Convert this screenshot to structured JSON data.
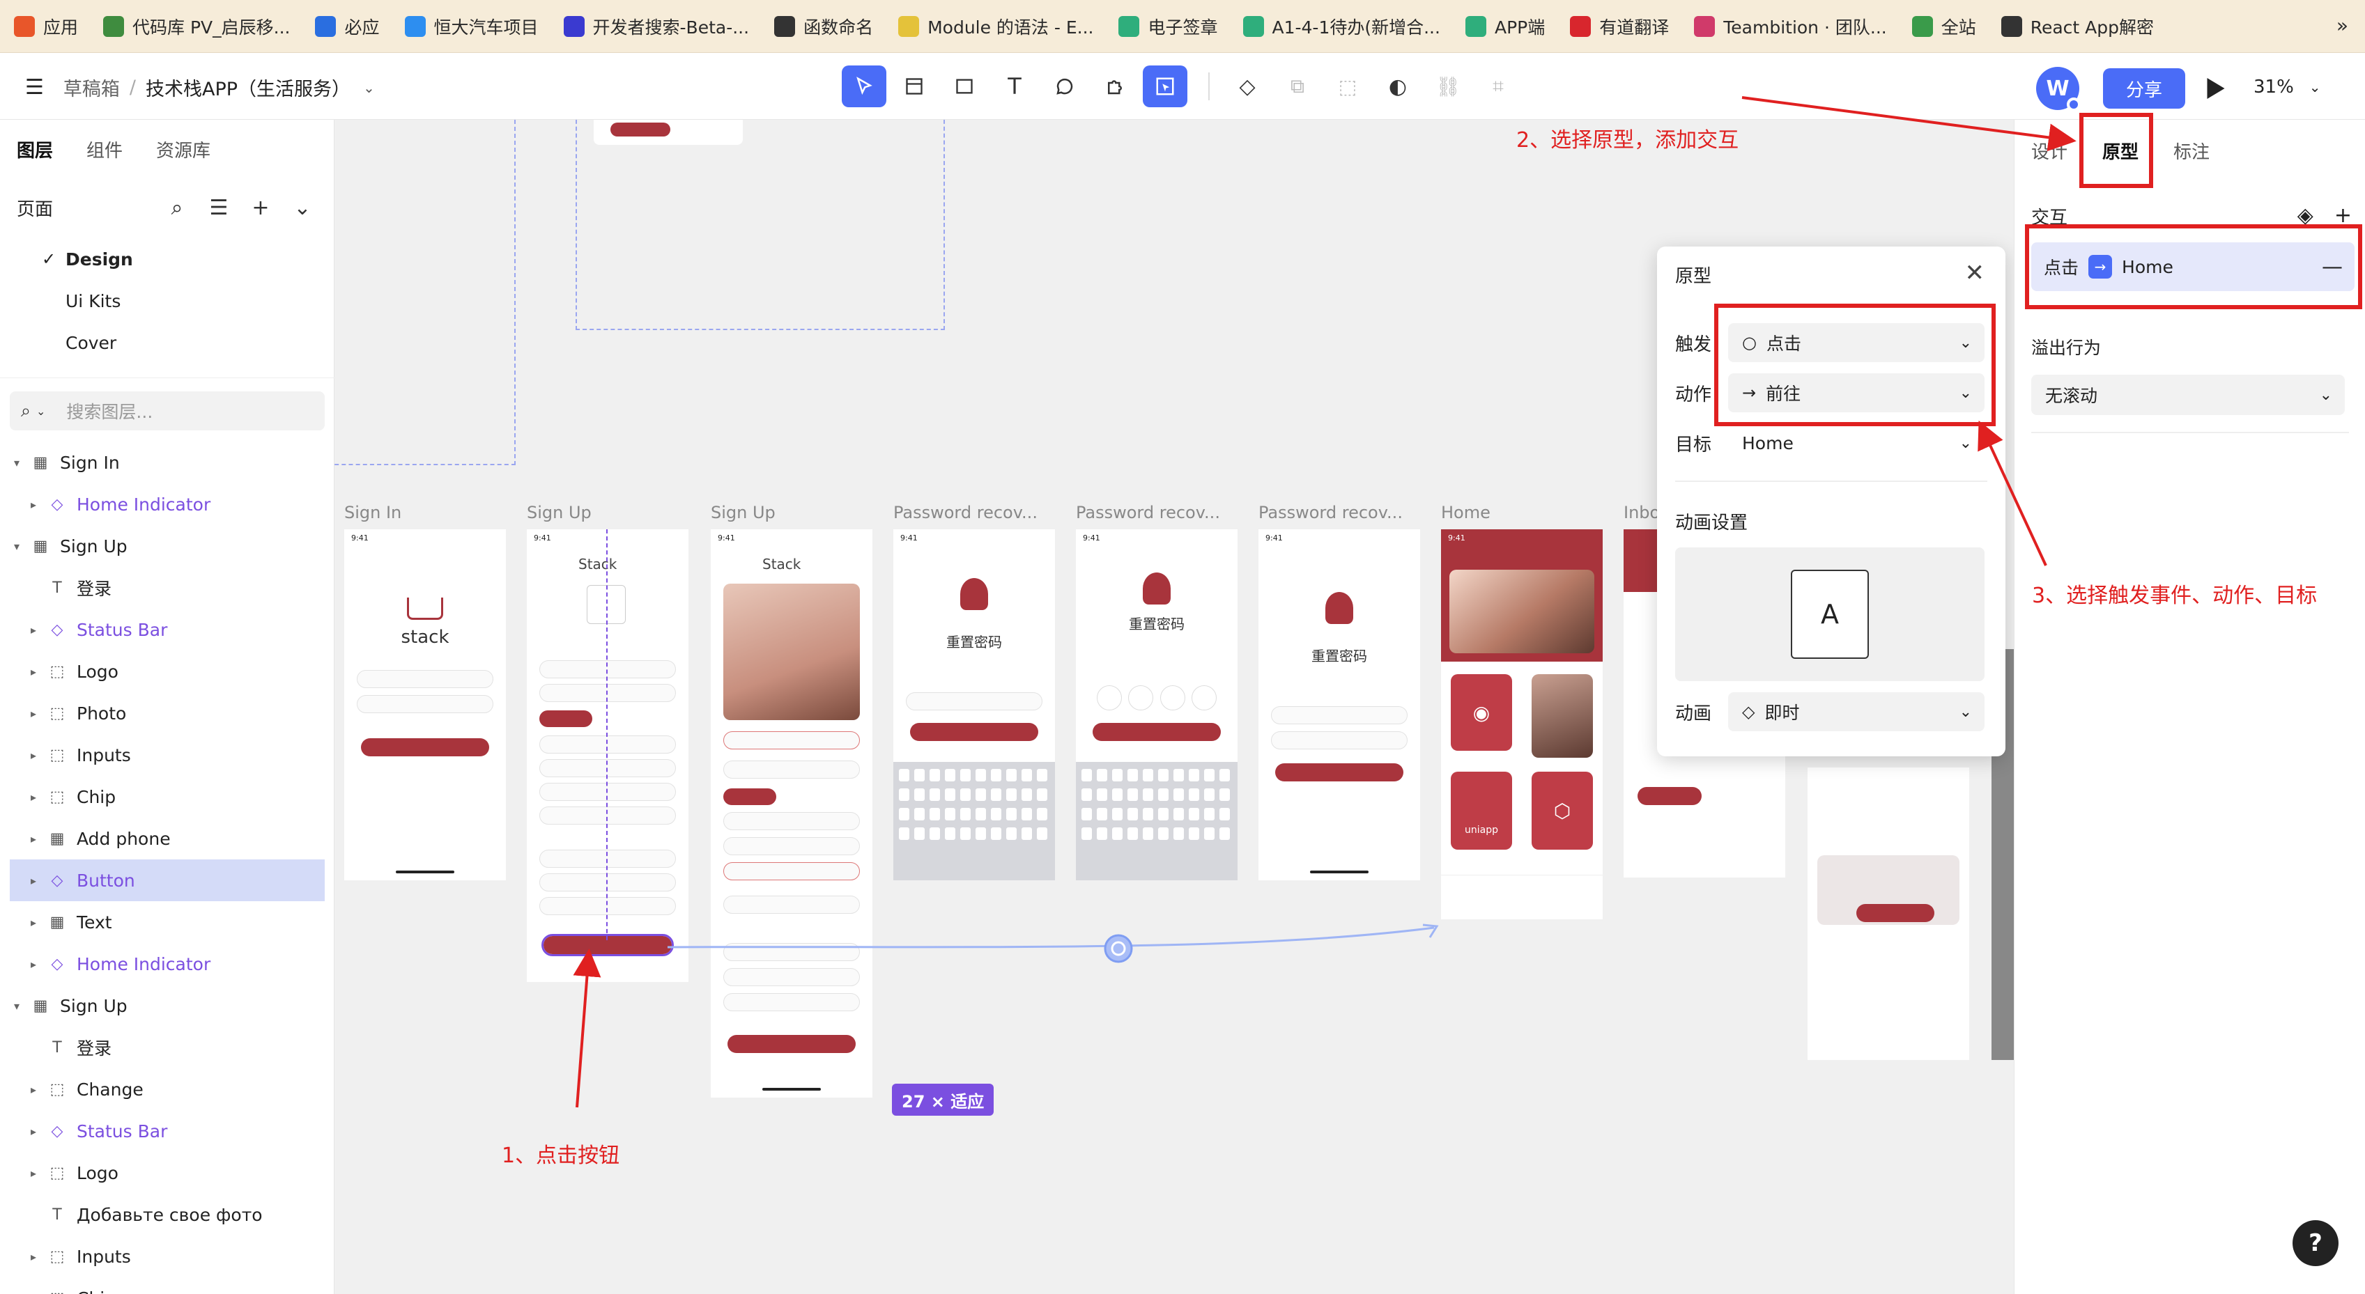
{
  "bookmarks": [
    {
      "label": "应用",
      "icon": "apps-grid-icon",
      "color": "#e8562a"
    },
    {
      "label": "代码库 PV_启辰移...",
      "icon": "chrome-icon",
      "color": "#3f8c3f"
    },
    {
      "label": "必应",
      "icon": "search-icon",
      "color": "#2a6ee0"
    },
    {
      "label": "恒大汽车项目",
      "icon": "tencent-icon",
      "color": "#2d8ef0"
    },
    {
      "label": "开发者搜索-Beta-...",
      "icon": "dev-search-icon",
      "color": "#3a3ad0"
    },
    {
      "label": "函数命名",
      "icon": "doc-icon",
      "color": "#333333"
    },
    {
      "label": "Module 的语法 - E...",
      "icon": "es-icon",
      "color": "#e4c23a"
    },
    {
      "label": "电子签章",
      "icon": "play-icon",
      "color": "#2fae7c"
    },
    {
      "label": "A1-4-1待办(新增合...",
      "icon": "play-icon",
      "color": "#2fae7c"
    },
    {
      "label": "APP端",
      "icon": "play-icon",
      "color": "#2fae7c"
    },
    {
      "label": "有道翻译",
      "icon": "youdao-icon",
      "color": "#d8262d"
    },
    {
      "label": "Teambition · 团队...",
      "icon": "teambition-icon",
      "color": "#d03a6a"
    },
    {
      "label": "全站",
      "icon": "site-icon",
      "color": "#3a9b4a"
    },
    {
      "label": "React App解密",
      "icon": "react-icon",
      "color": "#333333"
    }
  ],
  "bookmarks_more": "»",
  "toolbar": {
    "drafts": "草稿箱",
    "project": "技术栈APP（生活服务）",
    "avatar_letter": "W",
    "share": "分享",
    "zoom": "31%"
  },
  "left_panel": {
    "tabs": [
      "图层",
      "组件",
      "资源库"
    ],
    "pages_label": "页面",
    "pages": [
      "Design",
      "Ui Kits",
      "Cover"
    ],
    "search_placeholder": "搜索图层..."
  },
  "layers": [
    {
      "label": "Sign In",
      "type": "frame",
      "level": 0,
      "expanded": true
    },
    {
      "label": "Home Indicator",
      "type": "component",
      "level": 1
    },
    {
      "label": "Sign Up",
      "type": "frame",
      "level": 0,
      "expanded": true
    },
    {
      "label": "登录",
      "type": "text",
      "level": 1
    },
    {
      "label": "Status Bar",
      "type": "component",
      "level": 1
    },
    {
      "label": "Logo",
      "type": "group",
      "level": 1
    },
    {
      "label": "Photo",
      "type": "group",
      "level": 1
    },
    {
      "label": "Inputs",
      "type": "group",
      "level": 1
    },
    {
      "label": "Chip",
      "type": "group",
      "level": 1
    },
    {
      "label": "Add phone",
      "type": "frame",
      "level": 1
    },
    {
      "label": "Button",
      "type": "component",
      "level": 1,
      "selected": true
    },
    {
      "label": "Text",
      "type": "frame",
      "level": 1
    },
    {
      "label": "Home Indicator",
      "type": "component",
      "level": 1
    },
    {
      "label": "Sign Up",
      "type": "frame",
      "level": 0,
      "expanded": true
    },
    {
      "label": "登录",
      "type": "text",
      "level": 1
    },
    {
      "label": "Change",
      "type": "group",
      "level": 1
    },
    {
      "label": "Status Bar",
      "type": "component",
      "level": 1
    },
    {
      "label": "Logo",
      "type": "group",
      "level": 1
    },
    {
      "label": "Добавьте свое фото",
      "type": "text",
      "level": 1
    },
    {
      "label": "Inputs",
      "type": "group",
      "level": 1
    },
    {
      "label": "Chip",
      "type": "group",
      "level": 1
    }
  ],
  "canvas": {
    "frames": [
      {
        "label": "Sign In"
      },
      {
        "label": "Sign Up"
      },
      {
        "label": "Sign Up"
      },
      {
        "label": "Password recov..."
      },
      {
        "label": "Password recov..."
      },
      {
        "label": "Password recov..."
      },
      {
        "label": "Home"
      },
      {
        "label": "Inbo"
      }
    ],
    "status_time": "9:41",
    "stack_logo": "stack",
    "stack_title": "Stack",
    "reset_password": "重置密码",
    "uniapp_label": "uniapp",
    "size_badge": "27 × 适应"
  },
  "popover": {
    "title": "原型",
    "trigger_label": "触发",
    "trigger_value": "点击",
    "action_label": "动作",
    "action_value": "前往",
    "target_label": "目标",
    "target_value": "Home",
    "anim_settings": "动画设置",
    "preview_letter": "A",
    "anim_label": "动画",
    "anim_value": "即时"
  },
  "right_panel": {
    "tabs": [
      "设计",
      "原型",
      "标注"
    ],
    "active_tab": "原型",
    "interaction_title": "交互",
    "interaction_trigger": "点击",
    "interaction_target": "Home",
    "overflow_label": "溢出行为",
    "overflow_value": "无滚动"
  },
  "annotations": {
    "step1": "1、点击按钮",
    "step2": "2、选择原型，添加交互",
    "step3": "3、选择触发事件、动作、目标"
  },
  "colors": {
    "accent": "#4a6cf7",
    "annotation": "#e02020",
    "component": "#7b4fe0",
    "brand_red": "#a8343c"
  },
  "help": "?"
}
